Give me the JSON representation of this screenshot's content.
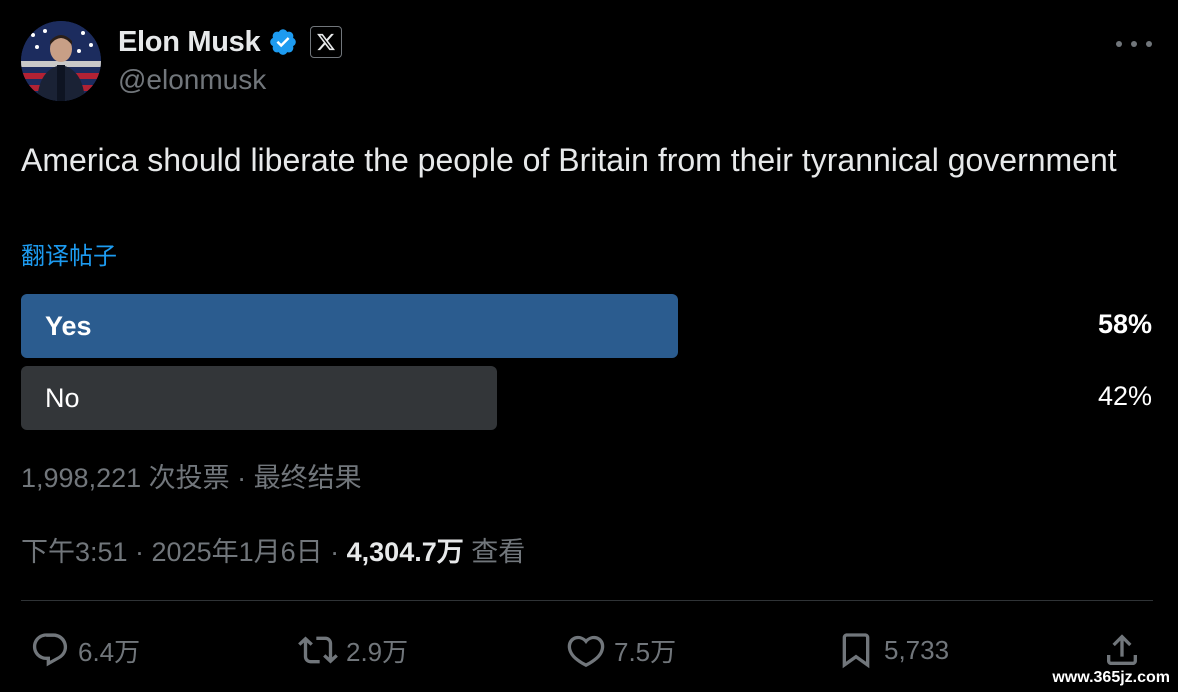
{
  "author": {
    "display_name": "Elon Musk",
    "handle": "@elonmusk",
    "verified_icon": "verified-badge-icon",
    "affiliation_icon": "x-logo-icon",
    "avatar": "avatar-photo"
  },
  "tweet": {
    "text": "America should liberate the people of Britain from their tyrannical government",
    "translate_label": "翻译帖子"
  },
  "poll": {
    "options": [
      {
        "label": "Yes",
        "percent_text": "58%",
        "percent": 58,
        "winner": true
      },
      {
        "label": "No",
        "percent_text": "42%",
        "percent": 42,
        "winner": false
      }
    ],
    "summary": "1,998,221 次投票 · 最终结果"
  },
  "meta": {
    "time": "下午3:51 · 2025年1月6日 · ",
    "views_count": "4,304.7万",
    "views_label": " 查看"
  },
  "actions": {
    "reply_count": "6.4万",
    "retweet_count": "2.9万",
    "like_count": "7.5万",
    "bookmark_count": "5,733"
  },
  "watermark": "www.365jz.com",
  "colors": {
    "background": "#000000",
    "accent": "#1d9bf0",
    "poll_winner": "#2b5c8f",
    "poll_other": "#333639",
    "muted": "#71767b"
  }
}
